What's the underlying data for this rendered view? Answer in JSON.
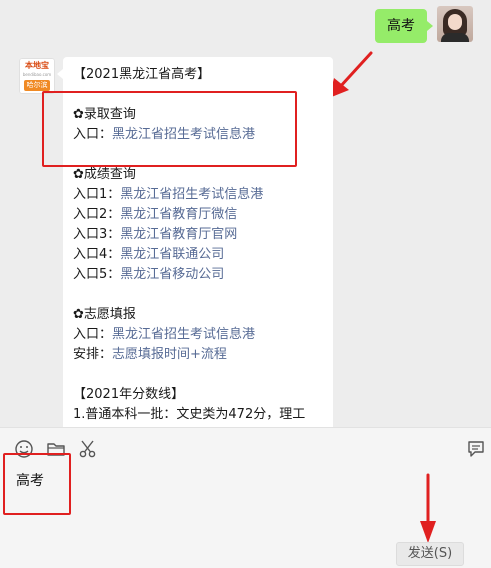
{
  "outgoing": {
    "text": "高考"
  },
  "sender_avatar": {
    "brand": "本地宝",
    "domain": "bendibao.com",
    "city": "哈尔滨"
  },
  "incoming": {
    "title": "【2021黑龙江省高考】",
    "admission": {
      "heading": "✿录取查询",
      "entry_label": "入口：",
      "entry_link": "黑龙江省招生考试信息港"
    },
    "scores": {
      "heading": "✿成绩查询",
      "entries": [
        {
          "label": "入口1：",
          "link": "黑龙江省招生考试信息港"
        },
        {
          "label": "入口2：",
          "link": "黑龙江省教育厅微信"
        },
        {
          "label": "入口3：",
          "link": "黑龙江省教育厅官网"
        },
        {
          "label": "入口4：",
          "link": "黑龙江省联通公司"
        },
        {
          "label": "入口5：",
          "link": "黑龙江省移动公司"
        }
      ]
    },
    "application": {
      "heading": "✿志愿填报",
      "entry_label": "入口：",
      "entry_link": "黑龙江省招生考试信息港",
      "schedule_label": "安排：",
      "schedule_link": "志愿填报时间+流程"
    },
    "cutoff": {
      "heading": "【2021年分数线】",
      "line1": "1.普通本科一批：文史类为472分，理工"
    }
  },
  "input": {
    "text": "高考"
  },
  "send_button": {
    "label": "发送(S)"
  },
  "colors": {
    "accent_red": "#e02020",
    "bubble_green": "#95ec69",
    "link_blue": "#576b95"
  }
}
